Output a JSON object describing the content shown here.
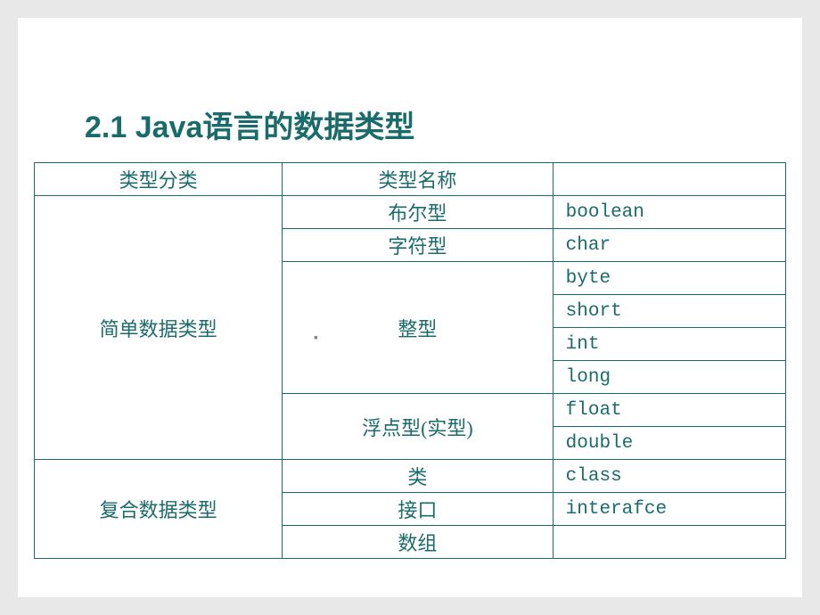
{
  "title": "2.1 Java语言的数据类型",
  "headers": {
    "category": "类型分类",
    "name": "类型名称",
    "keyword": ""
  },
  "categories": {
    "simple": "简单数据类型",
    "complex": "复合数据类型"
  },
  "rows": [
    {
      "name": "布尔型",
      "keyword": "boolean"
    },
    {
      "name": "字符型",
      "keyword": "char"
    },
    {
      "name": "整型",
      "keywords": [
        "byte",
        "short",
        "int",
        "long"
      ]
    },
    {
      "name": "浮点型(实型)",
      "keywords": [
        "float",
        "double"
      ]
    },
    {
      "name": "类",
      "keyword": "class"
    },
    {
      "name": "接口",
      "keyword": "interafce"
    },
    {
      "name": "数组",
      "keyword": ""
    }
  ],
  "marker": "▪"
}
